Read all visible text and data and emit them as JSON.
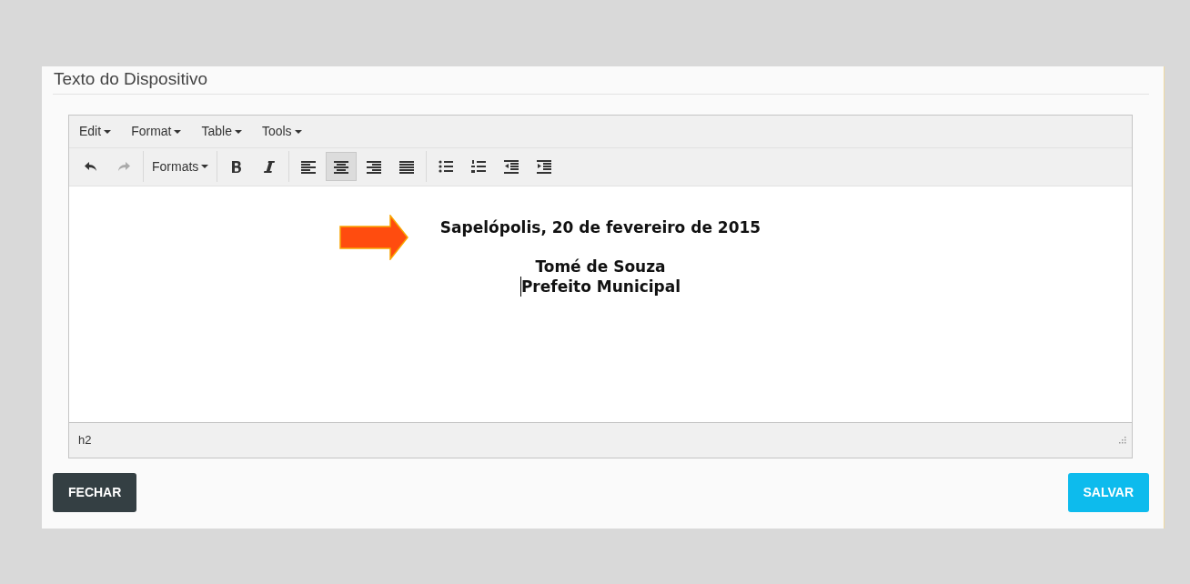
{
  "panel": {
    "title": "Texto do Dispositivo"
  },
  "editor": {
    "menus": [
      "Edit",
      "Format",
      "Table",
      "Tools"
    ],
    "toolbar": [
      [
        {
          "kind": "undo",
          "disabled": false,
          "selected": false
        },
        {
          "kind": "redo",
          "disabled": true,
          "selected": false
        }
      ],
      [
        {
          "kind": "formats",
          "label": "Formats",
          "disabled": false,
          "selected": false
        }
      ],
      [
        {
          "kind": "bold",
          "disabled": false,
          "selected": false
        },
        {
          "kind": "italic",
          "disabled": false,
          "selected": false
        }
      ],
      [
        {
          "kind": "align-left",
          "disabled": false,
          "selected": false
        },
        {
          "kind": "align-center",
          "disabled": false,
          "selected": true
        },
        {
          "kind": "align-right",
          "disabled": false,
          "selected": false
        },
        {
          "kind": "justify",
          "disabled": false,
          "selected": false
        }
      ],
      [
        {
          "kind": "bullet-list",
          "disabled": false,
          "selected": false
        },
        {
          "kind": "numbered-list",
          "disabled": false,
          "selected": false
        },
        {
          "kind": "outdent",
          "disabled": false,
          "selected": false
        },
        {
          "kind": "indent",
          "disabled": false,
          "selected": false
        }
      ]
    ],
    "content": [
      {
        "lines": [
          {
            "text": "Sapelópolis, 20 de fevereiro de 2015",
            "cursor": false
          }
        ]
      },
      {
        "lines": [
          {
            "text": "Tomé de Souza",
            "cursor": false
          },
          {
            "text": "Prefeito Municipal",
            "cursor": true
          }
        ]
      }
    ],
    "status_path": "h2"
  },
  "buttons": [
    {
      "label": "FECHAR",
      "kind": "dark"
    },
    {
      "label": "SALVAR",
      "kind": "info"
    }
  ]
}
